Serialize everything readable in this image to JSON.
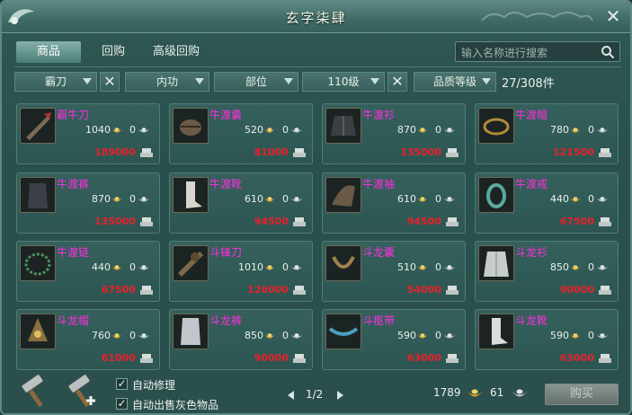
{
  "window": {
    "title": "玄字柒肆",
    "close_label": "✕"
  },
  "tabs": [
    {
      "label": "商品",
      "active": true
    },
    {
      "label": "回购",
      "active": false
    },
    {
      "label": "高级回购",
      "active": false
    }
  ],
  "search": {
    "placeholder": "输入名称进行搜索"
  },
  "filters": {
    "weapon": "霸刀",
    "skill": "内功",
    "slot": "部位",
    "level": "110级",
    "quality": "品质等级",
    "clear_label": "✕",
    "count": "27/308件"
  },
  "items": [
    {
      "name": "霸牛刀",
      "bind": "1040",
      "coin": "0",
      "price": "189000"
    },
    {
      "name": "牛渡囊",
      "bind": "520",
      "coin": "0",
      "price": "81000"
    },
    {
      "name": "牛渡衫",
      "bind": "870",
      "coin": "0",
      "price": "135000"
    },
    {
      "name": "牛渡帽",
      "bind": "780",
      "coin": "0",
      "price": "121500"
    },
    {
      "name": "牛渡裤",
      "bind": "870",
      "coin": "0",
      "price": "135000"
    },
    {
      "name": "牛渡靴",
      "bind": "610",
      "coin": "0",
      "price": "94500"
    },
    {
      "name": "牛渡袖",
      "bind": "610",
      "coin": "0",
      "price": "94500"
    },
    {
      "name": "牛渡戒",
      "bind": "440",
      "coin": "0",
      "price": "67500"
    },
    {
      "name": "牛渡链",
      "bind": "440",
      "coin": "0",
      "price": "67500"
    },
    {
      "name": "斗锋刀",
      "bind": "1010",
      "coin": "0",
      "price": "126000"
    },
    {
      "name": "斗龙囊",
      "bind": "510",
      "coin": "0",
      "price": "54000"
    },
    {
      "name": "斗龙衫",
      "bind": "850",
      "coin": "0",
      "price": "90000"
    },
    {
      "name": "斗龙帽",
      "bind": "760",
      "coin": "0",
      "price": "81000"
    },
    {
      "name": "斗龙裤",
      "bind": "850",
      "coin": "0",
      "price": "90000"
    },
    {
      "name": "斗枢带",
      "bind": "590",
      "coin": "0",
      "price": "63000"
    },
    {
      "name": "斗龙靴",
      "bind": "590",
      "coin": "0",
      "price": "63000"
    }
  ],
  "options": {
    "auto_repair": {
      "label": "自动修理",
      "checked": true,
      "mark": "✓"
    },
    "auto_sell_gray": {
      "label": "自动出售灰色物品",
      "checked": true,
      "mark": "✓"
    }
  },
  "pagination": {
    "current": "1/2"
  },
  "wallet": {
    "gold": "1789",
    "silver": "61"
  },
  "buy_button": {
    "label": "购买"
  },
  "colors": {
    "item_name": "#ff2ee0",
    "price": "#e8202a",
    "panel": "#2a4f4c"
  }
}
